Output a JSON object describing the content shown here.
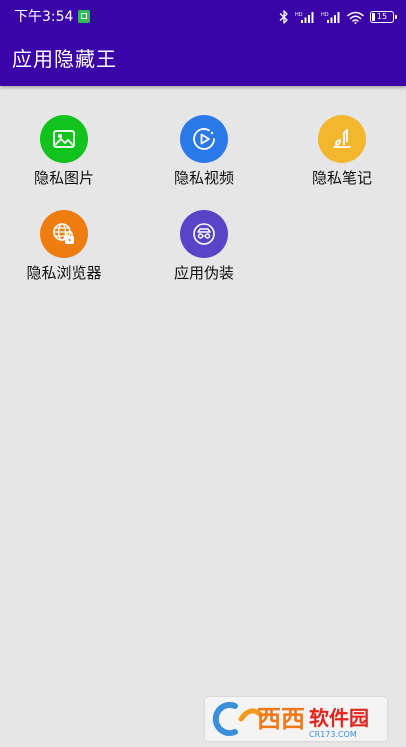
{
  "status_bar": {
    "time": "下午3:54",
    "battery": "15",
    "notification_icon": "gallery-notification-icon",
    "icons": [
      "bluetooth-icon",
      "signal-icon",
      "signal-icon",
      "wifi-icon",
      "battery-icon"
    ]
  },
  "toolbar": {
    "title": "应用隐藏王",
    "background_color": "#3a04a8"
  },
  "grid": {
    "items": [
      {
        "label": "隐私图片",
        "icon": "image-icon",
        "color": "#12c21d"
      },
      {
        "label": "隐私视频",
        "icon": "play-icon",
        "color": "#2a78ea"
      },
      {
        "label": "隐私笔记",
        "icon": "notes-icon",
        "color": "#f2b72e"
      },
      {
        "label": "隐私浏览器",
        "icon": "secure-browser-icon",
        "color": "#ee7d10"
      },
      {
        "label": "应用伪装",
        "icon": "disguise-icon",
        "color": "#5944c8"
      }
    ]
  },
  "watermark": {
    "logo": "cr173-watermark-logo",
    "text": "西西软件园 CR173.COM"
  }
}
